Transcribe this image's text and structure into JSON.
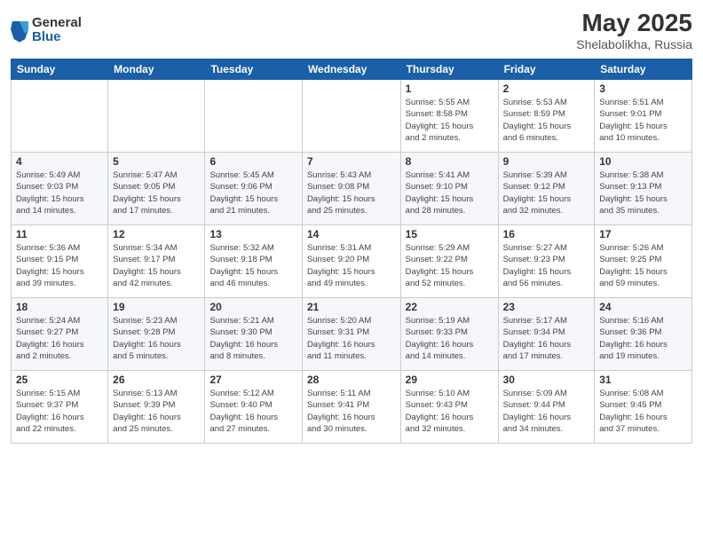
{
  "logo": {
    "general": "General",
    "blue": "Blue"
  },
  "header": {
    "month": "May 2025",
    "location": "Shelabolikha, Russia"
  },
  "weekdays": [
    "Sunday",
    "Monday",
    "Tuesday",
    "Wednesday",
    "Thursday",
    "Friday",
    "Saturday"
  ],
  "weeks": [
    [
      {
        "day": "",
        "info": ""
      },
      {
        "day": "",
        "info": ""
      },
      {
        "day": "",
        "info": ""
      },
      {
        "day": "",
        "info": ""
      },
      {
        "day": "1",
        "info": "Sunrise: 5:55 AM\nSunset: 8:58 PM\nDaylight: 15 hours\nand 2 minutes."
      },
      {
        "day": "2",
        "info": "Sunrise: 5:53 AM\nSunset: 8:59 PM\nDaylight: 15 hours\nand 6 minutes."
      },
      {
        "day": "3",
        "info": "Sunrise: 5:51 AM\nSunset: 9:01 PM\nDaylight: 15 hours\nand 10 minutes."
      }
    ],
    [
      {
        "day": "4",
        "info": "Sunrise: 5:49 AM\nSunset: 9:03 PM\nDaylight: 15 hours\nand 14 minutes."
      },
      {
        "day": "5",
        "info": "Sunrise: 5:47 AM\nSunset: 9:05 PM\nDaylight: 15 hours\nand 17 minutes."
      },
      {
        "day": "6",
        "info": "Sunrise: 5:45 AM\nSunset: 9:06 PM\nDaylight: 15 hours\nand 21 minutes."
      },
      {
        "day": "7",
        "info": "Sunrise: 5:43 AM\nSunset: 9:08 PM\nDaylight: 15 hours\nand 25 minutes."
      },
      {
        "day": "8",
        "info": "Sunrise: 5:41 AM\nSunset: 9:10 PM\nDaylight: 15 hours\nand 28 minutes."
      },
      {
        "day": "9",
        "info": "Sunrise: 5:39 AM\nSunset: 9:12 PM\nDaylight: 15 hours\nand 32 minutes."
      },
      {
        "day": "10",
        "info": "Sunrise: 5:38 AM\nSunset: 9:13 PM\nDaylight: 15 hours\nand 35 minutes."
      }
    ],
    [
      {
        "day": "11",
        "info": "Sunrise: 5:36 AM\nSunset: 9:15 PM\nDaylight: 15 hours\nand 39 minutes."
      },
      {
        "day": "12",
        "info": "Sunrise: 5:34 AM\nSunset: 9:17 PM\nDaylight: 15 hours\nand 42 minutes."
      },
      {
        "day": "13",
        "info": "Sunrise: 5:32 AM\nSunset: 9:18 PM\nDaylight: 15 hours\nand 46 minutes."
      },
      {
        "day": "14",
        "info": "Sunrise: 5:31 AM\nSunset: 9:20 PM\nDaylight: 15 hours\nand 49 minutes."
      },
      {
        "day": "15",
        "info": "Sunrise: 5:29 AM\nSunset: 9:22 PM\nDaylight: 15 hours\nand 52 minutes."
      },
      {
        "day": "16",
        "info": "Sunrise: 5:27 AM\nSunset: 9:23 PM\nDaylight: 15 hours\nand 56 minutes."
      },
      {
        "day": "17",
        "info": "Sunrise: 5:26 AM\nSunset: 9:25 PM\nDaylight: 15 hours\nand 59 minutes."
      }
    ],
    [
      {
        "day": "18",
        "info": "Sunrise: 5:24 AM\nSunset: 9:27 PM\nDaylight: 16 hours\nand 2 minutes."
      },
      {
        "day": "19",
        "info": "Sunrise: 5:23 AM\nSunset: 9:28 PM\nDaylight: 16 hours\nand 5 minutes."
      },
      {
        "day": "20",
        "info": "Sunrise: 5:21 AM\nSunset: 9:30 PM\nDaylight: 16 hours\nand 8 minutes."
      },
      {
        "day": "21",
        "info": "Sunrise: 5:20 AM\nSunset: 9:31 PM\nDaylight: 16 hours\nand 11 minutes."
      },
      {
        "day": "22",
        "info": "Sunrise: 5:19 AM\nSunset: 9:33 PM\nDaylight: 16 hours\nand 14 minutes."
      },
      {
        "day": "23",
        "info": "Sunrise: 5:17 AM\nSunset: 9:34 PM\nDaylight: 16 hours\nand 17 minutes."
      },
      {
        "day": "24",
        "info": "Sunrise: 5:16 AM\nSunset: 9:36 PM\nDaylight: 16 hours\nand 19 minutes."
      }
    ],
    [
      {
        "day": "25",
        "info": "Sunrise: 5:15 AM\nSunset: 9:37 PM\nDaylight: 16 hours\nand 22 minutes."
      },
      {
        "day": "26",
        "info": "Sunrise: 5:13 AM\nSunset: 9:39 PM\nDaylight: 16 hours\nand 25 minutes."
      },
      {
        "day": "27",
        "info": "Sunrise: 5:12 AM\nSunset: 9:40 PM\nDaylight: 16 hours\nand 27 minutes."
      },
      {
        "day": "28",
        "info": "Sunrise: 5:11 AM\nSunset: 9:41 PM\nDaylight: 16 hours\nand 30 minutes."
      },
      {
        "day": "29",
        "info": "Sunrise: 5:10 AM\nSunset: 9:43 PM\nDaylight: 16 hours\nand 32 minutes."
      },
      {
        "day": "30",
        "info": "Sunrise: 5:09 AM\nSunset: 9:44 PM\nDaylight: 16 hours\nand 34 minutes."
      },
      {
        "day": "31",
        "info": "Sunrise: 5:08 AM\nSunset: 9:45 PM\nDaylight: 16 hours\nand 37 minutes."
      }
    ]
  ]
}
